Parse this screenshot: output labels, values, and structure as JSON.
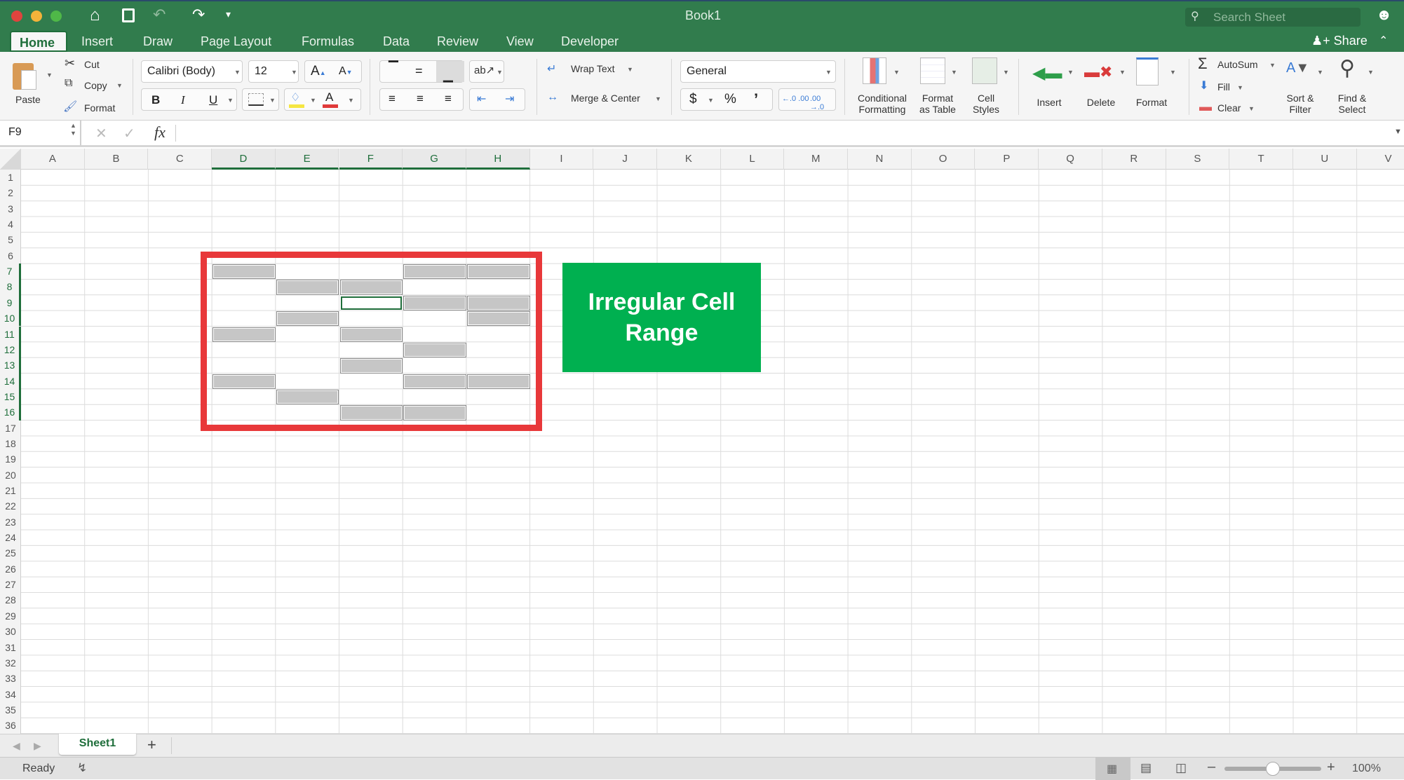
{
  "window": {
    "title": "Book1",
    "search_placeholder": "Search Sheet",
    "share_label": "Share"
  },
  "tabs": [
    "Home",
    "Insert",
    "Draw",
    "Page Layout",
    "Formulas",
    "Data",
    "Review",
    "View",
    "Developer"
  ],
  "active_tab": "Home",
  "ribbon": {
    "clipboard": {
      "paste": "Paste",
      "cut": "Cut",
      "copy": "Copy",
      "format": "Format"
    },
    "font": {
      "name": "Calibri (Body)",
      "size": "12",
      "bold": "B",
      "italic": "I",
      "underline": "U",
      "grow": "A",
      "shrink": "A",
      "font_color_glyph": "A",
      "fill_color": "#f5e642",
      "font_color": "#e03a3a"
    },
    "alignment": {
      "wrap_text": "Wrap Text",
      "merge_center": "Merge & Center"
    },
    "number": {
      "format": "General",
      "currency": "$",
      "percent": "%",
      "comma": "’",
      "inc_decimal": "←.0 .00",
      "dec_decimal": ".00 →.0"
    },
    "styles": {
      "conditional": [
        "Conditional",
        "Formatting"
      ],
      "format_table": [
        "Format",
        "as Table"
      ],
      "cell_styles": [
        "Cell",
        "Styles"
      ]
    },
    "cells": {
      "insert": "Insert",
      "delete": "Delete",
      "format": "Format"
    },
    "editing": {
      "autosum": "AutoSum",
      "fill": "Fill",
      "clear": "Clear",
      "sort_filter": [
        "Sort &",
        "Filter"
      ],
      "find_select": [
        "Find &",
        "Select"
      ]
    }
  },
  "formula_bar": {
    "name_box": "F9",
    "fx": "fx",
    "value": ""
  },
  "grid": {
    "columns": [
      "A",
      "B",
      "C",
      "D",
      "E",
      "F",
      "G",
      "H",
      "I",
      "J",
      "K",
      "L",
      "M",
      "N",
      "O",
      "P",
      "Q",
      "R",
      "S",
      "T",
      "U",
      "V"
    ],
    "selected_columns": [
      "D",
      "E",
      "F",
      "G",
      "H"
    ],
    "row_count": 36,
    "selected_rows": [
      7,
      8,
      9,
      10,
      11,
      12,
      13,
      14,
      15,
      16
    ],
    "active_cell": "F9",
    "selected_cells": [
      "D7",
      "G7",
      "H7",
      "E8",
      "F8",
      "G9",
      "H9",
      "E10",
      "H10",
      "D11",
      "F11",
      "G12",
      "F13",
      "D14",
      "G14",
      "H14",
      "E15",
      "F16",
      "G16"
    ]
  },
  "annotation": {
    "text_line1": "Irregular Cell",
    "text_line2": "Range",
    "box_color": "#00b050",
    "highlight_color": "#e8383a"
  },
  "sheets": [
    {
      "name": "Sheet1",
      "active": true
    }
  ],
  "add_sheet": "+",
  "status": {
    "text": "Ready",
    "zoom": "100%",
    "zoom_level": 0.5,
    "view": "normal"
  }
}
